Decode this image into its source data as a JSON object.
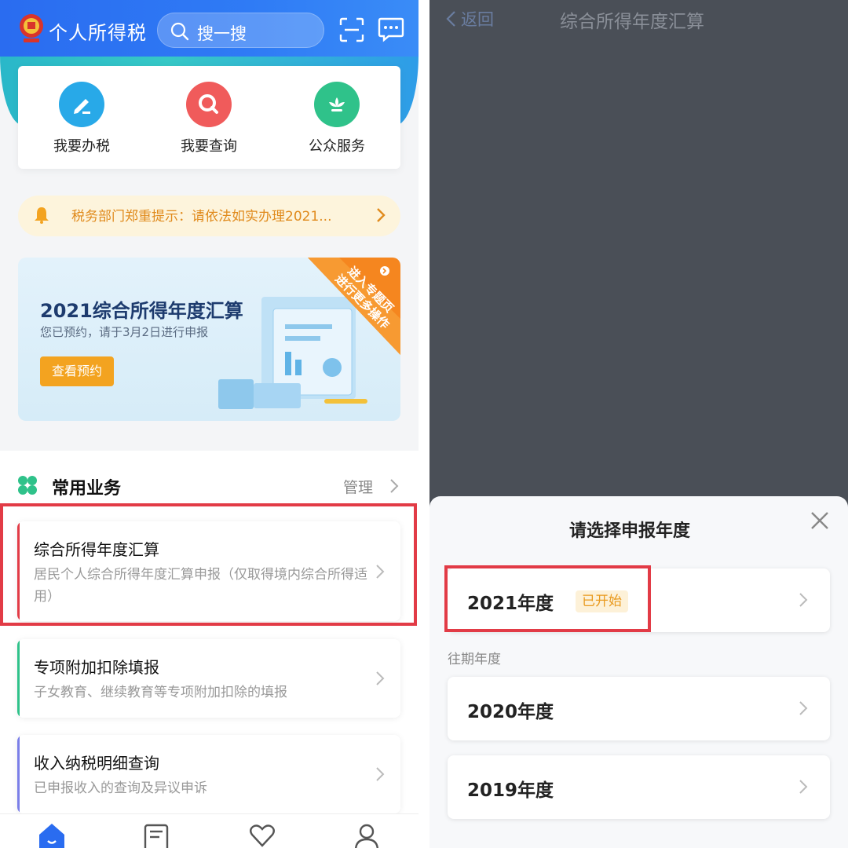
{
  "left_panel": {
    "header": {
      "app_title": "个人所得税",
      "search_placeholder": "搜一搜"
    },
    "quick_actions": [
      {
        "label": "我要办税",
        "icon": "edit-icon",
        "color": "#28a9e8"
      },
      {
        "label": "我要查询",
        "icon": "search-doc-icon",
        "color": "#f05b5b"
      },
      {
        "label": "公众服务",
        "icon": "flower-icon",
        "color": "#2fc28a"
      }
    ],
    "notice": {
      "text": "税务部门郑重提示：请依法如实办理2021..."
    },
    "banner": {
      "title": "2021综合所得年度汇算",
      "subtitle": "您已预约，请于3月2日进行申报",
      "button": "查看预约",
      "ribbon_line1": "进入专题页",
      "ribbon_line2": "进行更多操作"
    },
    "common_services": {
      "title": "常用业务",
      "manage_label": "管理",
      "items": [
        {
          "title": "综合所得年度汇算",
          "desc": "居民个人综合所得年度汇算申报（仅取得境内综合所得适用）",
          "accent": "#e23b46"
        },
        {
          "title": "专项附加扣除填报",
          "desc": "子女教育、继续教育等专项附加扣除的填报",
          "accent": "#2fc28a"
        },
        {
          "title": "收入纳税明细查询",
          "desc": "已申报收入的查询及异议申诉",
          "accent": "#7b7fe8"
        }
      ]
    },
    "tabbar": [
      {
        "icon": "home-icon"
      },
      {
        "icon": "document-icon"
      },
      {
        "icon": "heart-service-icon"
      },
      {
        "icon": "user-icon"
      }
    ]
  },
  "right_panel": {
    "nav": {
      "back_label": "返回",
      "title": "综合所得年度汇算"
    },
    "sheet": {
      "title": "请选择申报年度",
      "current_year": {
        "label": "2021年度",
        "badge": "已开始"
      },
      "past_label": "往期年度",
      "past_years": [
        {
          "label": "2020年度"
        },
        {
          "label": "2019年度"
        }
      ]
    }
  }
}
